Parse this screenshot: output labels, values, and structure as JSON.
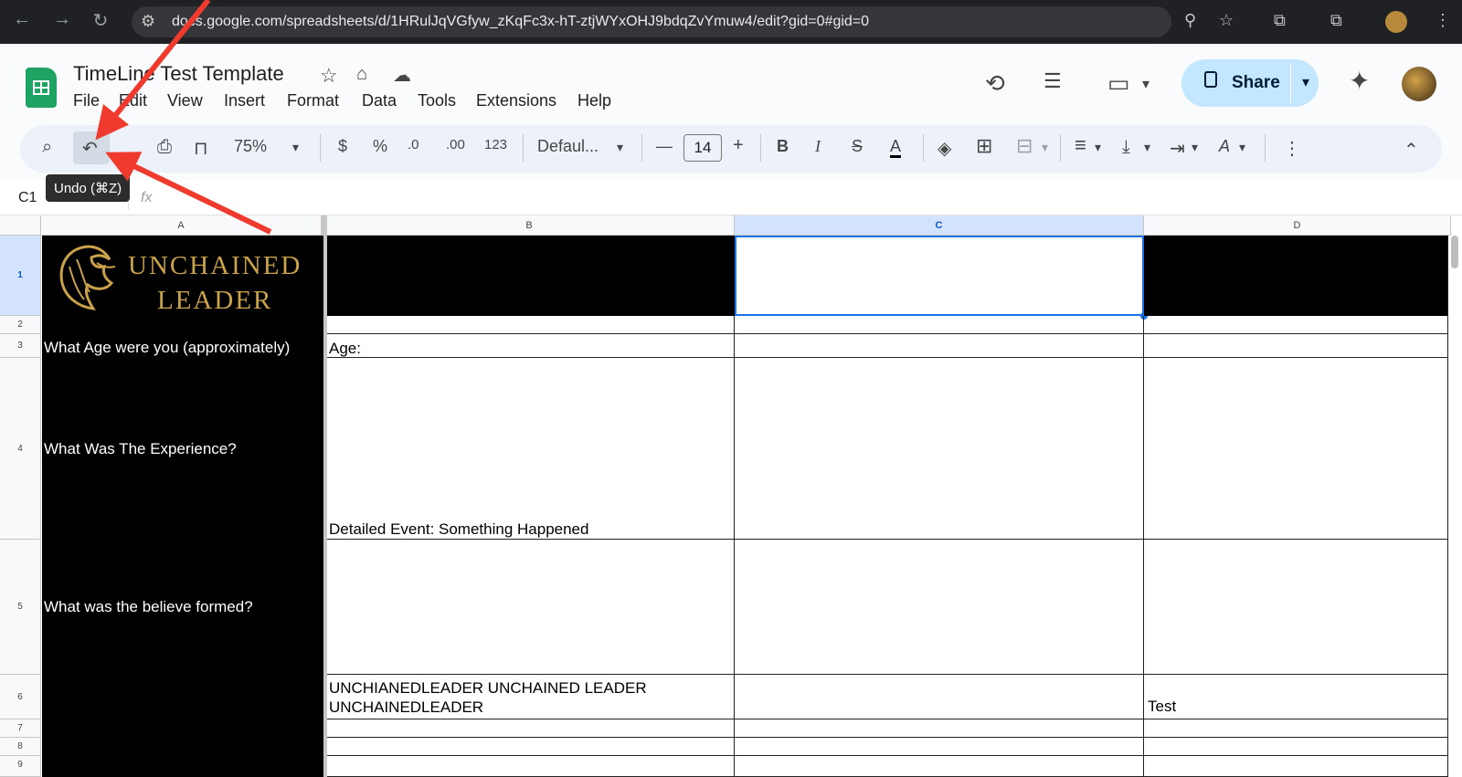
{
  "browser": {
    "url": "docs.google.com/spreadsheets/d/1HRulJqVGfyw_zKqFc3x-hT-ztjWYxOHJ9bdqZvYmuw4/edit?gid=0#gid=0",
    "back_icon": "←",
    "forward_icon": "→",
    "reload_icon": "↻",
    "site_info_icon": "⚙",
    "zoom_icon": "⚲",
    "star_icon": "☆",
    "extensions_icon": "⧉",
    "menu_icon": "⋮"
  },
  "app": {
    "doc_title": "TimeLine Test Template",
    "menu": [
      "File",
      "Edit",
      "View",
      "Insert",
      "Format",
      "Data",
      "Tools",
      "Extensions",
      "Help"
    ],
    "share_label": "Share",
    "star_icon": "☆",
    "move_icon": "⌂",
    "cloud_icon": "☁",
    "history_icon": "⟲",
    "comment_icon": "☰",
    "meet_icon": "▭",
    "gemini_icon": "✦"
  },
  "toolbar": {
    "search_icon": "⌕",
    "undo_icon": "↶",
    "print_icon": "⎙",
    "paint_icon": "⊓",
    "zoom": "75%",
    "currency": "$",
    "percent": "%",
    "dec_decrease": ".0",
    "dec_increase": ".00",
    "number_format": "123",
    "font": "Defaul...",
    "font_minus": "—",
    "font_size": "14",
    "font_plus": "+",
    "bold": "B",
    "italic": "I",
    "strike": "S",
    "text_color": "A",
    "fill_icon": "◈",
    "borders_icon": "⊞",
    "merge_icon": "⊟",
    "align_icon": "≡",
    "valign_icon": "⤓",
    "wrap_icon": "⇥",
    "rotate_icon": "A",
    "more_icon": "⋮",
    "collapse_icon": "⌃",
    "dropdown_icon": "▾"
  },
  "tooltip": "Undo (⌘Z)",
  "formula_bar": {
    "name_box": "C1",
    "fx": "fx"
  },
  "columns": [
    "A",
    "B",
    "C",
    "D"
  ],
  "rows": [
    "1",
    "2",
    "3",
    "4",
    "5",
    "6",
    "7",
    "8",
    "9"
  ],
  "cells": {
    "logo_line1": "UNCHAINED",
    "logo_line2": "LEADER",
    "a3": "What Age were you (approximately)",
    "a4": "What Was The Experience?",
    "a5": "What was the believe formed?",
    "b3": "Age:",
    "b4": "Detailed Event: Something Happened",
    "b6_line1": "UNCHIANEDLEADER   UNCHAINED LEADER",
    "b6_line2": "UNCHAINEDLEADER",
    "d6": "Test"
  },
  "colors": {
    "sheets_green": "#1ea362",
    "selection_blue": "#1a73e8",
    "annotation_red": "#f03a2e",
    "logo_gold": "#c9a24a"
  }
}
